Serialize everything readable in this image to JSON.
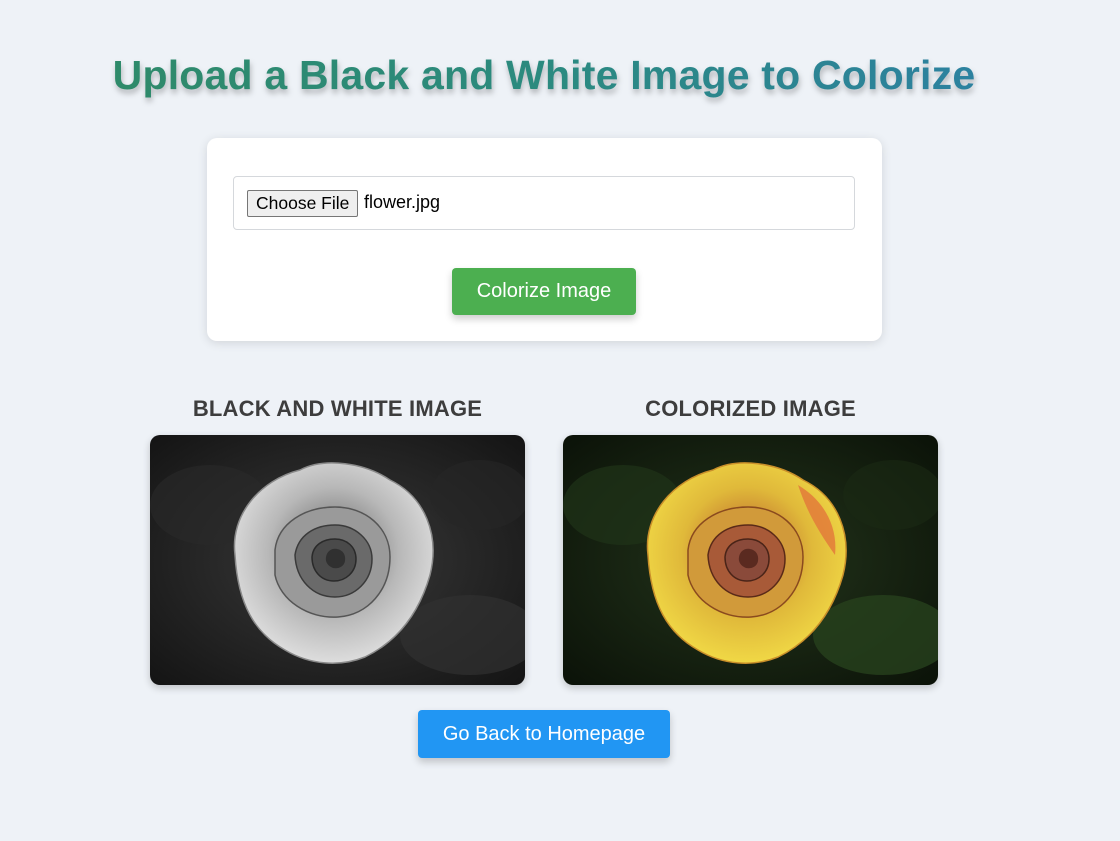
{
  "header": {
    "title": "Upload a Black and White Image to Colorize"
  },
  "upload_form": {
    "file_button_label": "Choose File",
    "selected_file_name": "flower.jpg",
    "submit_label": "Colorize Image"
  },
  "results": {
    "original": {
      "heading": "BLACK AND WHITE IMAGE",
      "image": "rose-grayscale-photo"
    },
    "colorized": {
      "heading": "COLORIZED IMAGE",
      "image": "rose-colorized-photo"
    }
  },
  "footer": {
    "home_button_label": "Go Back to Homepage"
  },
  "colors": {
    "page_background": "#eef2f7",
    "title_gradient": [
      "#2f8a64",
      "#2c7fa8"
    ],
    "colorize_button": "#4caf50",
    "home_button": "#2196f3",
    "heading_text": "#3d3d3d"
  }
}
